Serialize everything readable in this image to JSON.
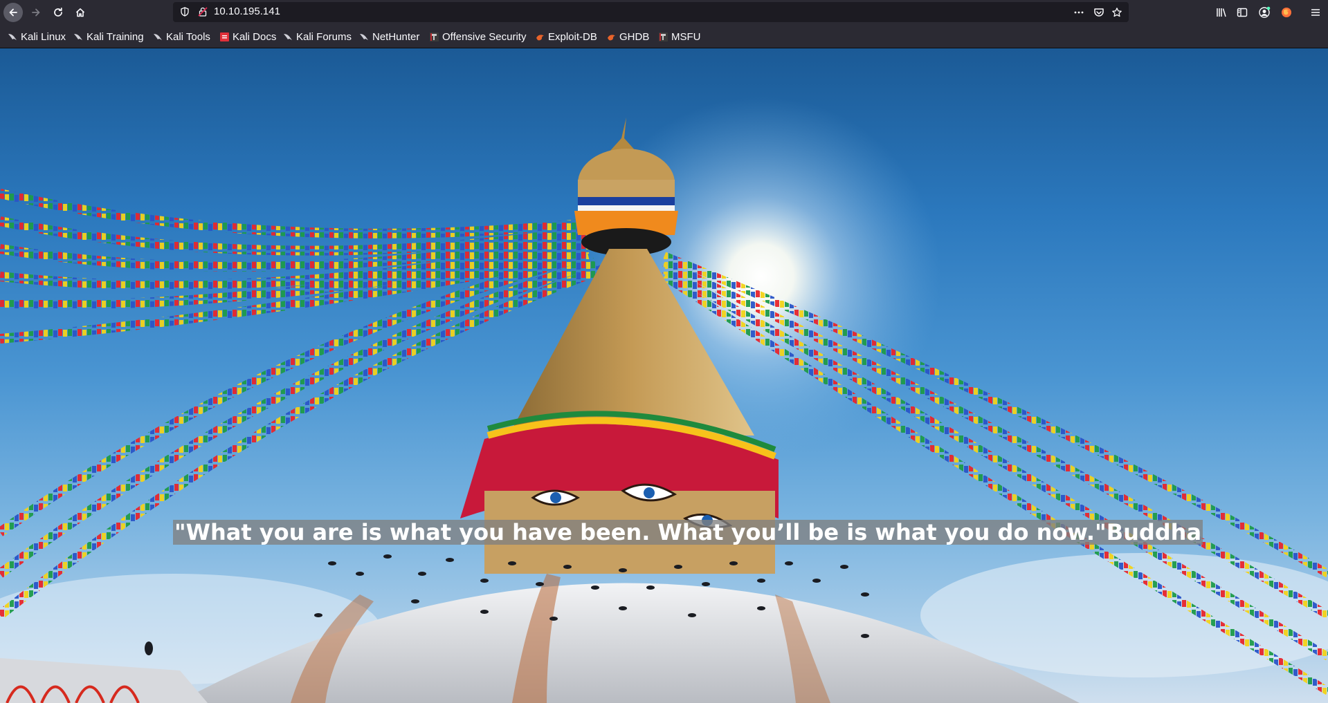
{
  "browser": {
    "url": "10.10.195.141",
    "bookmarks": [
      {
        "label": "Kali Linux",
        "icon": "kali-dragon-icon"
      },
      {
        "label": "Kali Training",
        "icon": "kali-dragon-icon"
      },
      {
        "label": "Kali Tools",
        "icon": "kali-dragon-icon"
      },
      {
        "label": "Kali Docs",
        "icon": "kali-docs-icon"
      },
      {
        "label": "Kali Forums",
        "icon": "kali-dragon-icon"
      },
      {
        "label": "NetHunter",
        "icon": "kali-dragon-icon"
      },
      {
        "label": "Offensive Security",
        "icon": "offsec-icon"
      },
      {
        "label": "Exploit-DB",
        "icon": "exploit-db-icon"
      },
      {
        "label": "GHDB",
        "icon": "exploit-db-icon"
      },
      {
        "label": "MSFU",
        "icon": "offsec-icon"
      }
    ],
    "colors": {
      "toolbar": "#2b2a33",
      "urlbar": "#1c1b22",
      "text": "#fbfbfe"
    }
  },
  "page": {
    "quote": "\"What you are is what you have been. What you’ll be is what you do now.\"Buddha",
    "background": "stupa-with-prayer-flags-photo"
  }
}
